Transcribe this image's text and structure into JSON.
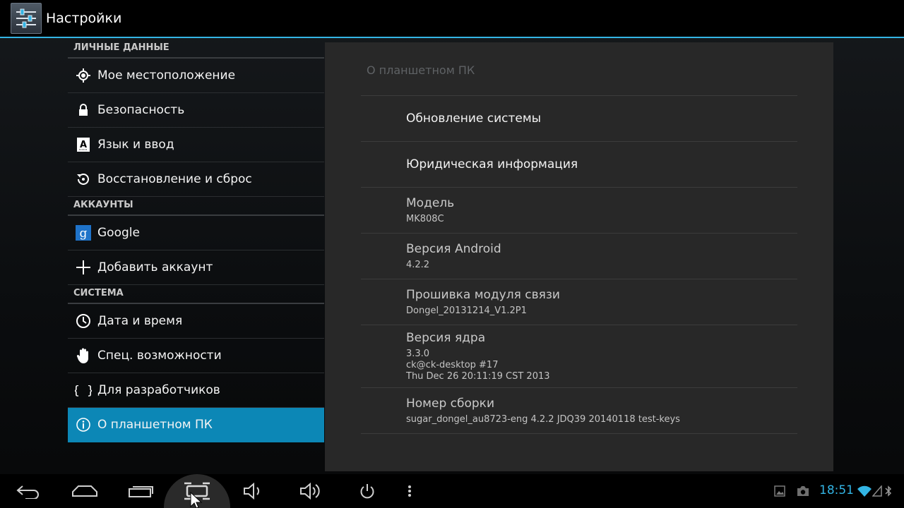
{
  "app": {
    "title": "Настройки",
    "icon": "settings-sliders-icon"
  },
  "sidebar": {
    "sections": [
      {
        "header": "ЛИЧНЫЕ ДАННЫЕ",
        "items": [
          {
            "label": "Мое местоположение",
            "icon": "location-icon"
          },
          {
            "label": "Безопасность",
            "icon": "lock-icon"
          },
          {
            "label": "Язык и ввод",
            "icon": "keyboard-letter-icon"
          },
          {
            "label": "Восстановление и сброс",
            "icon": "restore-icon"
          }
        ]
      },
      {
        "header": "АККАУНТЫ",
        "items": [
          {
            "label": "Google",
            "icon": "google-icon"
          },
          {
            "label": "Добавить аккаунт",
            "icon": "plus-icon"
          }
        ]
      },
      {
        "header": "СИСТЕМА",
        "items": [
          {
            "label": "Дата и время",
            "icon": "clock-icon"
          },
          {
            "label": "Спец. возможности",
            "icon": "hand-icon"
          },
          {
            "label": "Для разработчиков",
            "icon": "braces-icon"
          },
          {
            "label": "О планшетном ПК",
            "icon": "info-icon",
            "selected": true
          }
        ]
      }
    ]
  },
  "detail": {
    "title": "О планшетном ПК",
    "rows": [
      {
        "title": "Обновление системы"
      },
      {
        "title": "Юридическая информация"
      },
      {
        "title": "Модель",
        "summary": "MK808C"
      },
      {
        "title": "Версия Android",
        "summary": "4.2.2"
      },
      {
        "title": "Прошивка модуля связи",
        "summary": "Dongel_20131214_V1.2P1"
      },
      {
        "title": "Версия ядра",
        "summary_lines": [
          "3.3.0",
          "ck@ck-desktop #17",
          "Thu Dec 26 20:11:19 CST 2013"
        ]
      },
      {
        "title": "Номер сборки",
        "summary": "sugar_dongel_au8723-eng 4.2.2 JDQ39 20140118 test-keys"
      }
    ]
  },
  "navbar": {
    "buttons": [
      "back-icon",
      "home-icon",
      "recent-apps-icon",
      "screenshot-icon",
      "volume-down-icon",
      "volume-up-icon",
      "power-icon",
      "menu-icon"
    ],
    "status": {
      "time": "18:51",
      "icons": [
        "gallery-notification-icon",
        "camera-notification-icon",
        "wifi-icon",
        "signal-icon",
        "bluetooth-icon"
      ]
    }
  },
  "colors": {
    "accent": "#33b5e5",
    "selected": "#0c87b6",
    "panel": "#282828"
  }
}
